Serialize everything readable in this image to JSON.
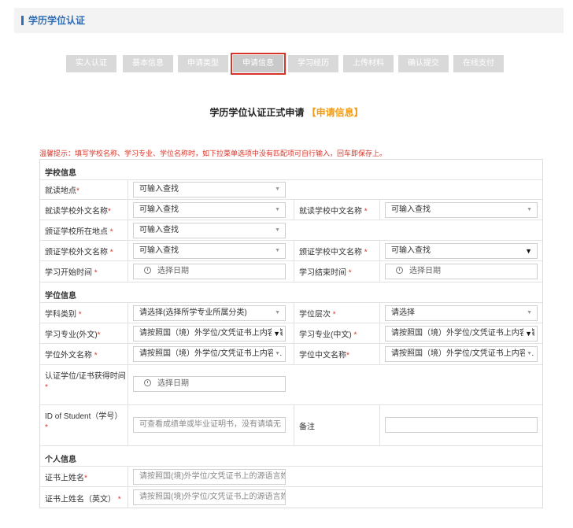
{
  "header": {
    "title": "学历学位认证"
  },
  "steps": [
    {
      "label": "实人认证",
      "active": false
    },
    {
      "label": "基本信息",
      "active": false
    },
    {
      "label": "申请类型",
      "active": false
    },
    {
      "label": "申请信息",
      "active": true
    },
    {
      "label": "学习经历",
      "active": false
    },
    {
      "label": "上传材料",
      "active": false
    },
    {
      "label": "确认提交",
      "active": false
    },
    {
      "label": "在线支付",
      "active": false
    }
  ],
  "form_title": {
    "main": "学历学位认证正式申请",
    "highlight": "【申请信息】"
  },
  "tip": "温馨提示：填写学校名称、学习专业、学位名称时，如下拉菜单选项中没有匹配项可自行输入，回车即保存上。",
  "sections": {
    "school": "学校信息",
    "degree": "学位信息",
    "personal": "个人信息"
  },
  "fields": {
    "study_location": {
      "label": "就读地点",
      "value": "可输入查找"
    },
    "school_foreign_name": {
      "label": "就读学校外文名称",
      "value": "可输入查找"
    },
    "school_chinese_name": {
      "label": "就读学校中文名称",
      "value": "可输入查找"
    },
    "issuing_school_location": {
      "label": "颁证学校所在地点",
      "value": "可输入查找"
    },
    "issuing_school_foreign": {
      "label": "颁证学校外文名称",
      "value": "可输入查找"
    },
    "issuing_school_chinese": {
      "label": "颁证学校中文名称",
      "value": "可输入查找"
    },
    "study_start": {
      "label": "学习开始时间",
      "value": "选择日期"
    },
    "study_end": {
      "label": "学习结束时间",
      "value": "选择日期"
    },
    "discipline": {
      "label": "学科类别",
      "value": "请选择(选择所学专业所属分类)"
    },
    "degree_level": {
      "label": "学位层次",
      "value": "请选择"
    },
    "major_foreign": {
      "label": "学习专业(外文)",
      "value": "请按照国（境）外学位/文凭证书上内容填"
    },
    "major_chinese": {
      "label": "学习专业(中文)",
      "value": "请按照国（境）外学位/文凭证书上内容填"
    },
    "degree_foreign": {
      "label": "学位外文名称",
      "value": "请按照国（境）外学位/文凭证书上内容..."
    },
    "degree_chinese": {
      "label": "学位中文名称",
      "value": "请按照国（境）外学位/文凭证书上内容..."
    },
    "award_time": {
      "label": "认证学位/证书获得时间",
      "value": "选择日期"
    },
    "student_id": {
      "label": "ID of Student（学号）",
      "placeholder": "可查看成绩单或毕业证明书，没有请填无"
    },
    "remark": {
      "label": "备注",
      "placeholder": ""
    },
    "cert_name": {
      "label": "证书上姓名",
      "placeholder": "请按照国(境)外学位/文凭证书上的源语言姓名|"
    },
    "cert_name_en": {
      "label": "证书上姓名（英文）",
      "placeholder": "请按照国(境)外学位/文凭证书上的源语言姓名|"
    }
  }
}
